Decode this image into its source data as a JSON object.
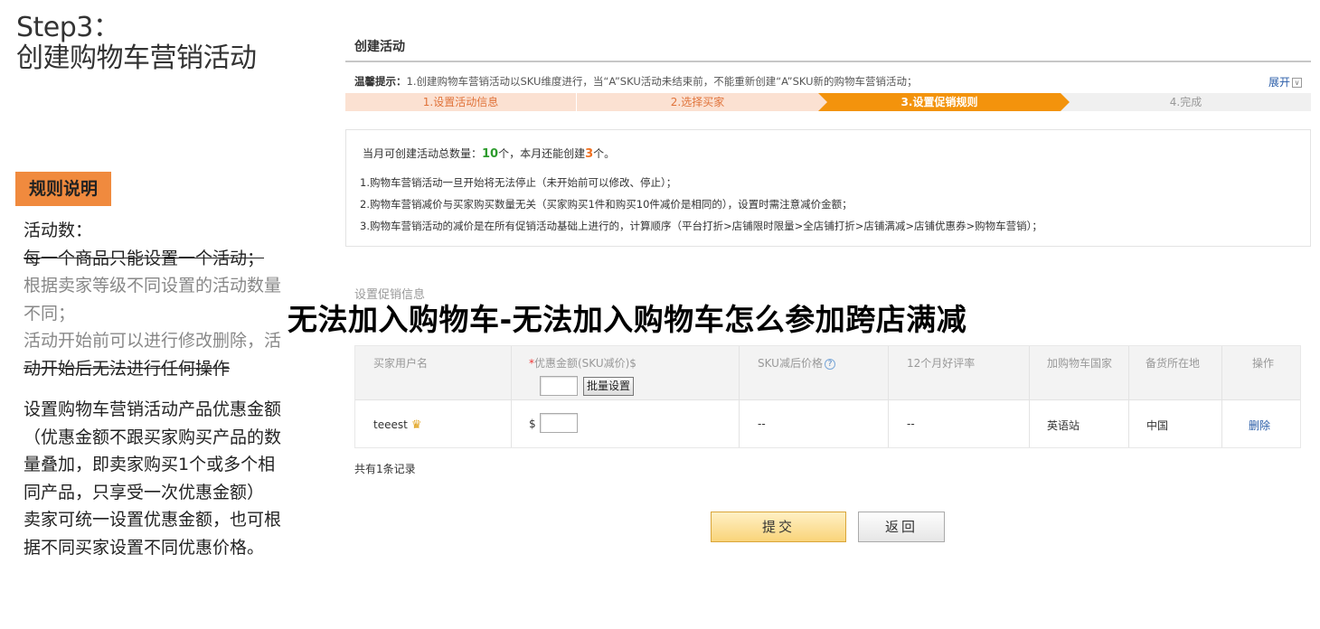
{
  "annotation": {
    "step_line1": "Step3：",
    "step_line2": "创建购物车营销活动",
    "rules_tag": "规则说明",
    "rules_lines": [
      "活动数：",
      "每一个商品只能设置一个活动；",
      "根据卖家等级不同设置的活动数量",
      "不同；",
      "活动开始前可以进行修改删除，活",
      "动开始后无法进行任何操作"
    ],
    "desc_lines": [
      "设置购物车营销活动产品优惠金额",
      "（优惠金额不跟买家购买产品的数",
      "量叠加，即卖家购买1个或多个相",
      "同产品，只享受一次优惠金额）",
      "卖家可统一设置优惠金额，也可根",
      "据不同买家设置不同优惠价格。"
    ]
  },
  "headline": "无法加入购物车-无法加入购物车怎么参加跨店满减",
  "panel": {
    "title": "创建活动",
    "tip_label": "温馨提示：",
    "tip_text": "1.创建购物车营销活动以SKU维度进行，当“A”SKU活动未结束前，不能重新创建“A”SKU新的购物车营销活动；",
    "expand_label": "展开",
    "steps": [
      {
        "label": "1.设置活动信息",
        "state": "done"
      },
      {
        "label": "2.选择买家",
        "state": "done"
      },
      {
        "label": "3.设置促销规则",
        "state": "current"
      },
      {
        "label": "4.完成",
        "state": "todo"
      }
    ],
    "quota": {
      "prefix": "当月可创建活动总数量：",
      "total": "10",
      "middle": "个，本月还能创建",
      "remaining": "3",
      "suffix": "个。"
    },
    "rules": [
      "1.购物车营销活动一旦开始将无法停止（未开始前可以修改、停止）；",
      "2.购物车营销减价与买家购买数量无关（买家购买1件和购买10件减价是相同的），设置时需注意减价金额；",
      "3.购物车营销活动的减价是在所有促销活动基础上进行的，计算顺序（平台打折>店铺限时限量>全店铺打折>店铺满减>店铺优惠券>购物车营销）；"
    ],
    "section_title": "设置促销信息",
    "table": {
      "headers": {
        "buyer": "买家用户名",
        "required_mark": "*",
        "discount": "优惠金额(SKU减价)$",
        "after_price": "SKU减后价格",
        "rating": "12个月好评率",
        "country": "加购物车国家",
        "warehouse": "备货所在地",
        "action": "操作"
      },
      "batch_button": "批量设置",
      "rows": [
        {
          "buyer": "teeest",
          "currency": "$",
          "after_price": "--",
          "rating": "--",
          "country": "英语站",
          "warehouse": "中国",
          "action": "删除"
        }
      ]
    },
    "record_count": "共有1条记录",
    "submit_label": "提交",
    "back_label": "返回"
  },
  "colors": {
    "accent_orange": "#f3930c",
    "step_done_bg": "#fbe1d2",
    "tag_orange": "#f08a3e",
    "link_blue": "#2a5da8",
    "quota_green": "#2d9b2d"
  },
  "icons": {
    "crown": "crown-icon",
    "help": "question-circle-icon",
    "expand": "chevron-down-icon"
  }
}
